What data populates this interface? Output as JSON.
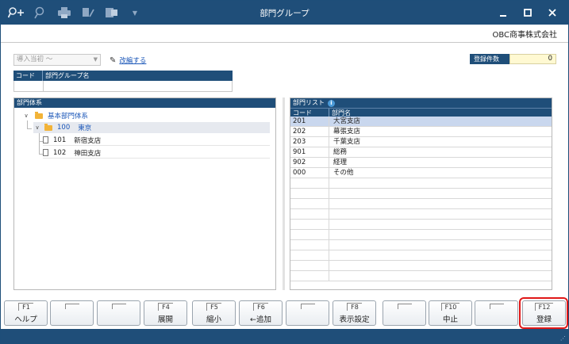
{
  "window": {
    "title": "部門グループ",
    "company": "OBC商事株式会社"
  },
  "toolbar": {
    "icons": [
      "search-add-icon",
      "zoom-icon",
      "print-icon",
      "print-settings-icon",
      "export-icon",
      "dropdown-icon"
    ]
  },
  "controls": {
    "select_value": "導入当初 ～",
    "edit_link": "改編する",
    "count_label": "登録件数",
    "count_value": "0"
  },
  "group_table": {
    "col_code": "コード",
    "col_name": "部門グループ名"
  },
  "tree": {
    "header": "部門体系",
    "root": "基本部門体系",
    "node_code": "100",
    "node_name": "東京",
    "children": [
      {
        "code": "101",
        "name": "新宿支店"
      },
      {
        "code": "102",
        "name": "神田支店"
      }
    ]
  },
  "dept_list": {
    "header": "部門リスト",
    "col_code": "コード",
    "col_name": "部門名",
    "rows": [
      {
        "code": "201",
        "name": "大宮支店"
      },
      {
        "code": "202",
        "name": "幕張支店"
      },
      {
        "code": "203",
        "name": "千葉支店"
      },
      {
        "code": "901",
        "name": "総務"
      },
      {
        "code": "902",
        "name": "経理"
      },
      {
        "code": "000",
        "name": "その他"
      }
    ]
  },
  "fkeys": [
    {
      "num": "F1",
      "label": "ヘルプ"
    },
    {
      "num": "",
      "label": ""
    },
    {
      "num": "",
      "label": ""
    },
    {
      "num": "F4",
      "label": "展開"
    },
    {
      "num": "F5",
      "label": "縮小"
    },
    {
      "num": "F6",
      "label": "←追加"
    },
    {
      "num": "",
      "label": ""
    },
    {
      "num": "F8",
      "label": "表示設定"
    },
    {
      "num": "",
      "label": ""
    },
    {
      "num": "F10",
      "label": "中止"
    },
    {
      "num": "",
      "label": ""
    },
    {
      "num": "F12",
      "label": "登録"
    }
  ],
  "colors": {
    "titlebar": "#1f4e79",
    "selected_row": "#c9d7ee",
    "highlight": "#e01818",
    "count_bg": "#fff9d2"
  }
}
